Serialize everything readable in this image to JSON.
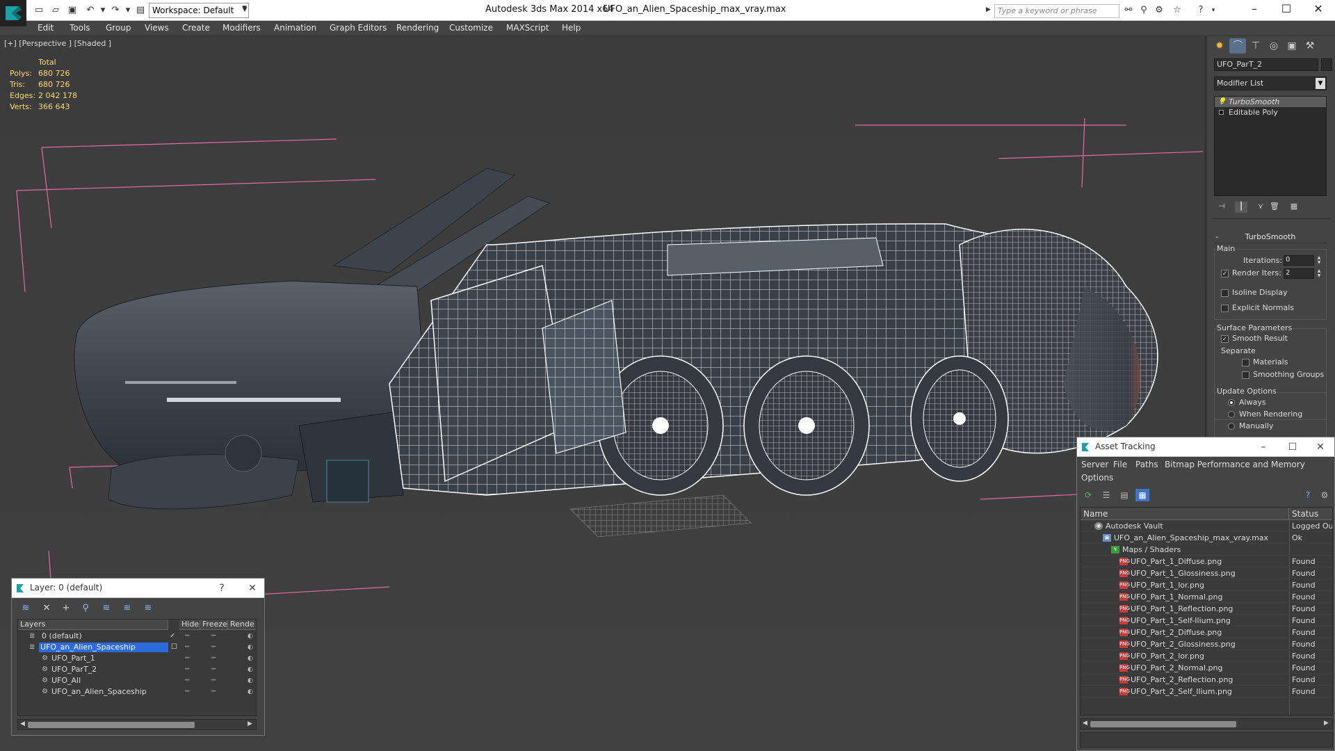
{
  "titlebar": {
    "workspace_label": "Workspace: Default",
    "app_title": "Autodesk 3ds Max  2014 x64",
    "file_title": "UFO_an_Alien_Spaceship_max_vray.max",
    "search_placeholder": "Type a keyword or phrase"
  },
  "menubar": {
    "items": [
      "Edit",
      "Tools",
      "Group",
      "Views",
      "Create",
      "Modifiers",
      "Animation",
      "Graph Editors",
      "Rendering",
      "Customize",
      "MAXScript",
      "Help"
    ]
  },
  "viewport": {
    "label": "[+] [Perspective ] [Shaded ]",
    "stats": {
      "header": "Total",
      "polys_label": "Polys:",
      "polys": "680 726",
      "tris_label": "Tris:",
      "tris": "680 726",
      "edges_label": "Edges:",
      "edges": "2 042 178",
      "verts_label": "Verts:",
      "verts": "366 643"
    }
  },
  "command_panel": {
    "object_name": "UFO_ParT_2",
    "modifier_list": "Modifier List",
    "stack": [
      "TurboSmooth",
      "Editable Poly"
    ],
    "turbosmooth": {
      "title": "TurboSmooth",
      "main_label": "Main",
      "iterations_label": "Iterations:",
      "iterations": "0",
      "render_iters_label": "Render Iters:",
      "render_iters": "2",
      "render_iters_checked": true,
      "isoline_label": "Isoline Display",
      "explicit_label": "Explicit Normals",
      "surface_label": "Surface Parameters",
      "smooth_result_label": "Smooth Result",
      "separate_label": "Separate",
      "materials_label": "Materials",
      "smoothing_groups_label": "Smoothing Groups",
      "update_label": "Update Options",
      "always_label": "Always",
      "when_rendering_label": "When Rendering",
      "manually_label": "Manually"
    }
  },
  "layer_window": {
    "title": "Layer: 0 (default)",
    "help": "?",
    "columns": [
      "Layers",
      "Hide",
      "Freeze",
      "Rende"
    ],
    "rows": [
      {
        "name": "0 (default)",
        "level": 0,
        "selected": false,
        "active": true
      },
      {
        "name": "UFO_an_Alien_Spaceship",
        "level": 0,
        "selected": true,
        "active": false
      },
      {
        "name": "UFO_Part_1",
        "level": 1,
        "selected": false,
        "active": false
      },
      {
        "name": "UFO_ParT_2",
        "level": 1,
        "selected": false,
        "active": false
      },
      {
        "name": "UFO_All",
        "level": 1,
        "selected": false,
        "active": false
      },
      {
        "name": "UFO_an_Alien_Spaceship",
        "level": 1,
        "selected": false,
        "active": false
      }
    ]
  },
  "asset_window": {
    "title": "Asset Tracking",
    "menu": [
      "Server",
      "File",
      "Paths",
      "Bitmap Performance and Memory",
      "Options"
    ],
    "columns": [
      "Name",
      "Status"
    ],
    "rows": [
      {
        "name": "Autodesk Vault",
        "status": "Logged Out",
        "level": 0,
        "icon": "vault"
      },
      {
        "name": "UFO_an_Alien_Spaceship_max_vray.max",
        "status": "Ok",
        "level": 1,
        "icon": "file"
      },
      {
        "name": "Maps / Shaders",
        "status": "",
        "level": 2,
        "icon": "maps"
      },
      {
        "name": "UFO_Part_1_Diffuse.png",
        "status": "Found",
        "level": 3,
        "icon": "png"
      },
      {
        "name": "UFO_Part_1_Glossiness.png",
        "status": "Found",
        "level": 3,
        "icon": "png"
      },
      {
        "name": "UFO_Part_1_lor.png",
        "status": "Found",
        "level": 3,
        "icon": "png"
      },
      {
        "name": "UFO_Part_1_Normal.png",
        "status": "Found",
        "level": 3,
        "icon": "png"
      },
      {
        "name": "UFO_Part_1_Reflection.png",
        "status": "Found",
        "level": 3,
        "icon": "png"
      },
      {
        "name": "UFO_Part_1_Self-Ilium.png",
        "status": "Found",
        "level": 3,
        "icon": "png"
      },
      {
        "name": "UFO_Part_2_Diffuse.png",
        "status": "Found",
        "level": 3,
        "icon": "png"
      },
      {
        "name": "UFO_Part_2_Glossiness.png",
        "status": "Found",
        "level": 3,
        "icon": "png"
      },
      {
        "name": "UFO_Part_2_lor.png",
        "status": "Found",
        "level": 3,
        "icon": "png"
      },
      {
        "name": "UFO_Part_2_Normal.png",
        "status": "Found",
        "level": 3,
        "icon": "png"
      },
      {
        "name": "UFO_Part_2_Reflection.png",
        "status": "Found",
        "level": 3,
        "icon": "png"
      },
      {
        "name": "UFO_Part_2_Self_Ilium.png",
        "status": "Found",
        "level": 3,
        "icon": "png"
      }
    ]
  },
  "icons": {
    "app_logo": "3ds-max-logo-icon",
    "minimize": "–",
    "maximize": "☐",
    "close": "✕"
  },
  "colors": {
    "accent": "#2c6bd9",
    "stats_text": "#ffdf6a",
    "selection_bbox": "#e36ba0",
    "wireframe": "#ffffff"
  }
}
